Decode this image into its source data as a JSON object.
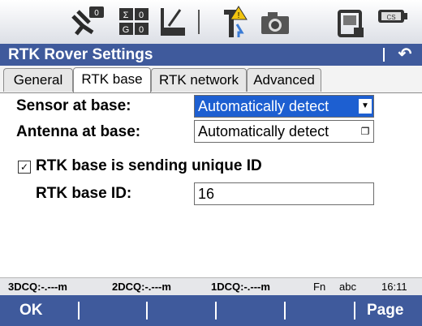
{
  "app": {
    "title": "RTK Rover Settings"
  },
  "toolbar_icons": [
    "satellite-icon",
    "grid-count-icon",
    "toolbox-icon",
    "antenna-warning-icon",
    "camera-icon",
    "device-icon",
    "battery-icon"
  ],
  "tabs": [
    {
      "label": "General"
    },
    {
      "label": "RTK base"
    },
    {
      "label": "RTK network"
    },
    {
      "label": "Advanced"
    }
  ],
  "form": {
    "sensor_label": "Sensor at base:",
    "sensor_value": "Automatically detect",
    "antenna_label": "Antenna at base:",
    "antenna_value": "Automatically detect",
    "unique_id_label": "RTK base is sending unique ID",
    "unique_id_checked": true,
    "base_id_label": "RTK base ID:",
    "base_id_value": "16"
  },
  "status": {
    "dcq3": "3DCQ:-.---m",
    "dcq2": "2DCQ:-.---m",
    "dcq1": "1DCQ:-.---m",
    "fn": "Fn",
    "abc": "abc",
    "time": "16:11"
  },
  "softkeys": {
    "ok": "OK",
    "page": "Page"
  },
  "colors": {
    "titlebar": "#3f5a9c",
    "selection": "#1d5fd1"
  }
}
